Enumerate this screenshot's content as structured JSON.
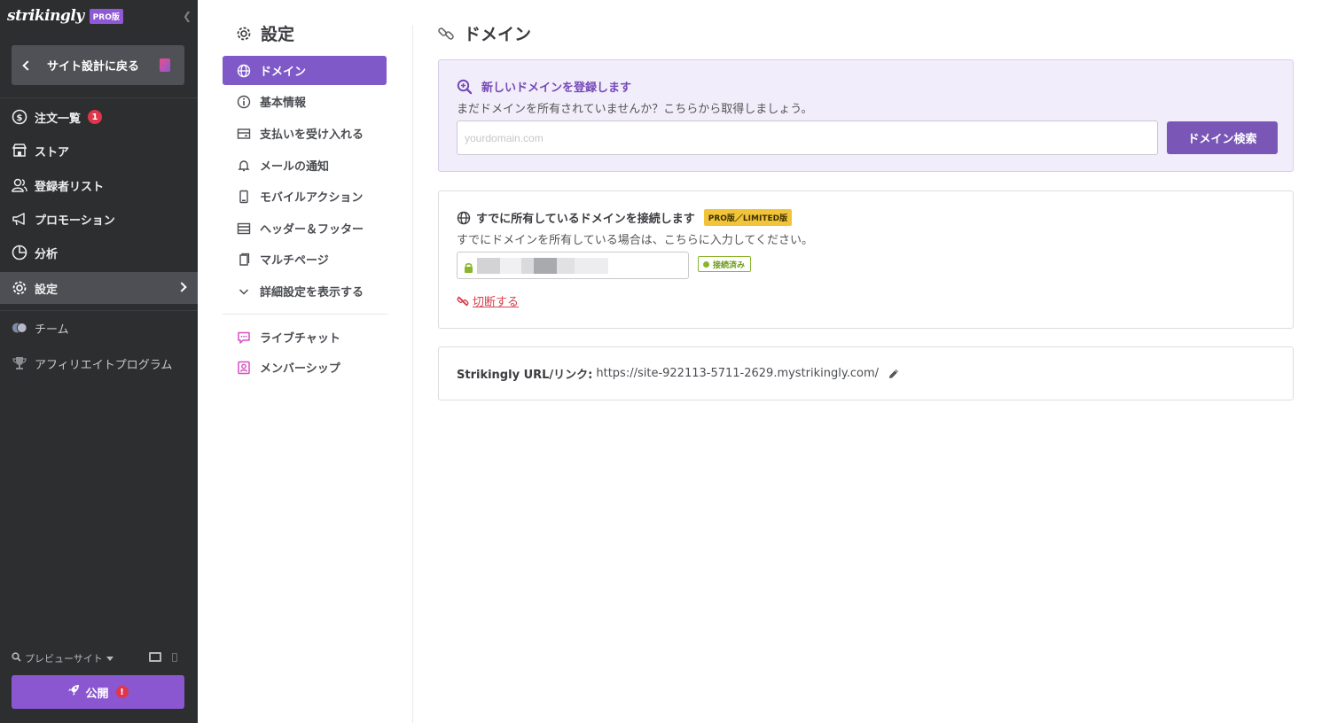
{
  "sidebar": {
    "logo": "strikingly",
    "pro_badge": "PRO版",
    "back_label": "サイト設計に戻る",
    "items": [
      {
        "label": "注文一覧",
        "badge": "1"
      },
      {
        "label": "ストア"
      },
      {
        "label": "登録者リスト"
      },
      {
        "label": "プロモーション"
      },
      {
        "label": "分析"
      },
      {
        "label": "設定"
      },
      {
        "label": "チーム"
      },
      {
        "label": "アフィリエイトプログラム"
      }
    ],
    "preview_label": "プレビューサイト",
    "publish_label": "公開",
    "publish_warning": "!"
  },
  "settings_nav": {
    "title": "設定",
    "items": [
      {
        "label": "ドメイン",
        "active": true
      },
      {
        "label": "基本情報"
      },
      {
        "label": "支払いを受け入れる"
      },
      {
        "label": "メールの通知"
      },
      {
        "label": "モバイルアクション"
      },
      {
        "label": "ヘッダー＆フッター"
      },
      {
        "label": "マルチページ"
      },
      {
        "label": "詳細設定を表示する"
      },
      {
        "label": "ライブチャット"
      },
      {
        "label": "メンバーシップ"
      }
    ]
  },
  "main": {
    "title": "ドメイン",
    "new_domain": {
      "heading": "新しいドメインを登録します",
      "description": "まだドメインを所有されていませんか？こちらから取得しましょう。",
      "placeholder": "yourdomain.com",
      "search_button": "ドメイン検索"
    },
    "own_domain": {
      "heading": "すでに所有しているドメインを接続します",
      "tag": "PRO版／LIMITED版",
      "description": "すでにドメインを所有している場合は、こちらに入力してください。",
      "status": "接続済み",
      "disconnect": "切断する"
    },
    "url": {
      "label": "Strikingly URL/リンク:",
      "value": "https://site-922113-5711-2629.mystrikingly.com/"
    }
  },
  "colors": {
    "sidebar_bg": "#2d2e30",
    "accent_purple": "#7f59c8",
    "badge_red": "#e0364b",
    "connected_green": "#8ab52c",
    "tag_yellow": "#f2c43a"
  }
}
